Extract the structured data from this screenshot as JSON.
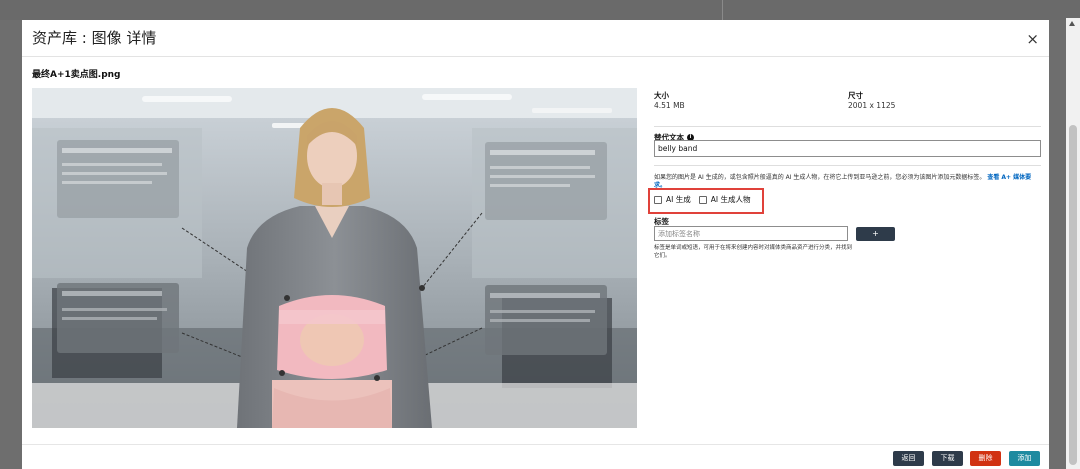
{
  "modal": {
    "title": "资产库 : 图像 详情",
    "close_icon": "×",
    "filename": "最终A+1卖点图.png"
  },
  "meta": {
    "size_label": "大小",
    "size_value": "4.51 MB",
    "dim_label": "尺寸",
    "dim_value": "2001 x 1125"
  },
  "alt_text": {
    "label": "替代文本",
    "value": "belly band"
  },
  "ai_notice": {
    "text": "如果您的图片是 AI 生成的，或包含照片般逼真的 AI 生成人物，在将它上传到亚马逊之前，您必须为该图片添加元数据标签。",
    "link": "查看 A+ 媒体要求。"
  },
  "ai_checkboxes": {
    "ai_generated": "AI 生成",
    "ai_person": "AI 生成人物"
  },
  "tags": {
    "label": "标签",
    "placeholder": "添加标签名称",
    "add_button": "+",
    "hint": "标签是单词或短语，可用于在将来创建内容时对媒体类商品资产进行分类，并找到它们。"
  },
  "footer": {
    "back": "返回",
    "download": "下载",
    "delete": "删除",
    "add": "添加"
  },
  "colors": {
    "primary_button": "#2e3b4a",
    "danger_button": "#d13212",
    "accent_button": "#1e8aa0",
    "highlight_border": "#e0413a"
  }
}
